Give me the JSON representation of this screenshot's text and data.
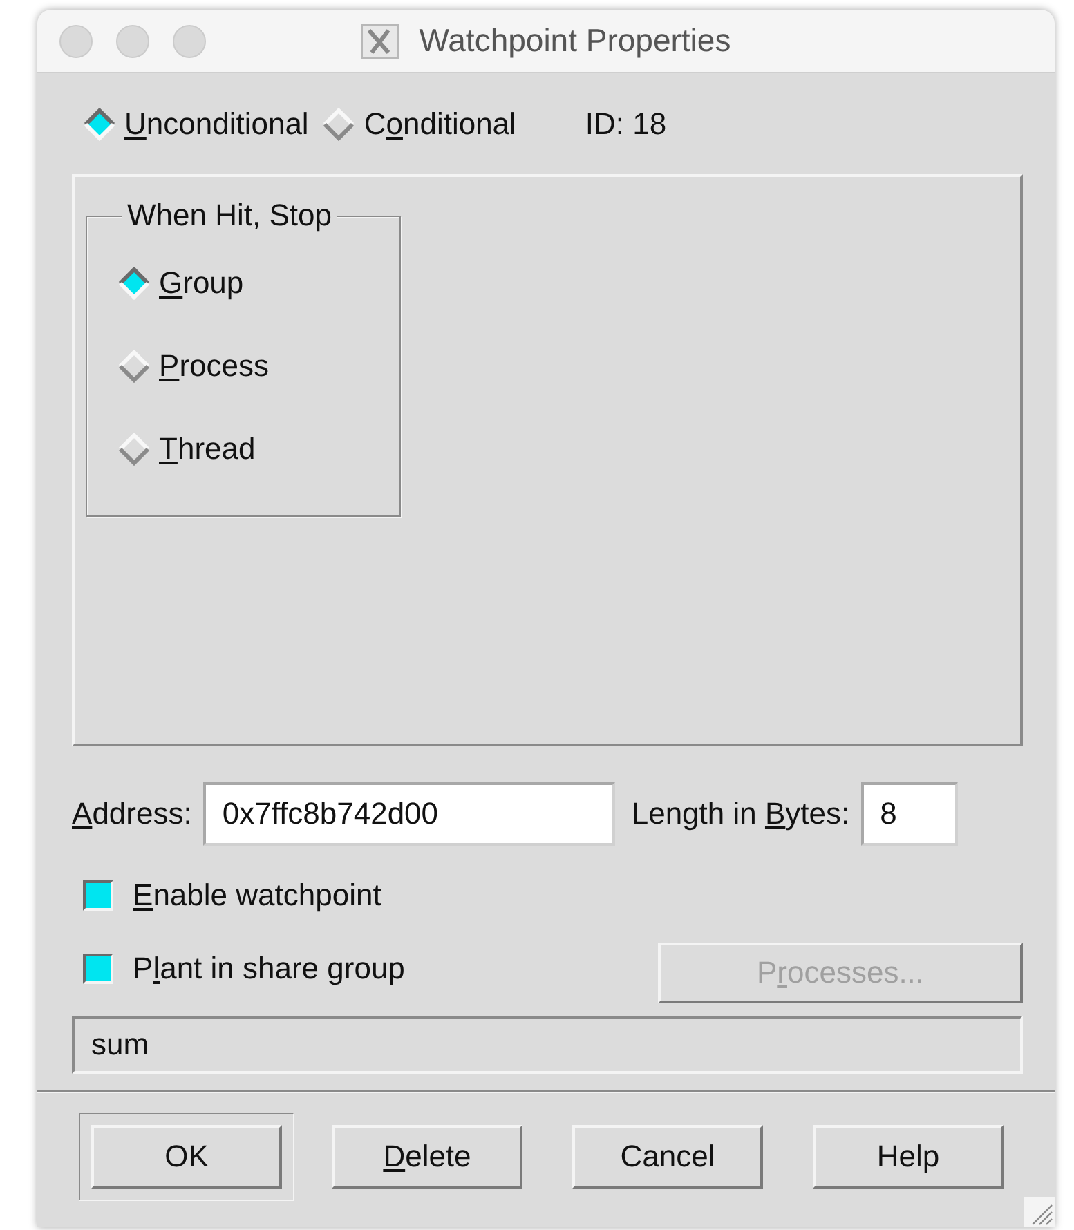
{
  "window": {
    "title": "Watchpoint Properties"
  },
  "condition_options": [
    {
      "label": {
        "key": "U",
        "post": "nconditional"
      },
      "selected": true
    },
    {
      "label": {
        "pre": "C",
        "key": "o",
        "post": "nditional"
      },
      "selected": false
    }
  ],
  "id_label": "ID: 18",
  "stop_group": {
    "title": "When Hit, Stop",
    "options": [
      {
        "label": {
          "key": "G",
          "post": "roup"
        },
        "selected": true
      },
      {
        "label": {
          "key": "P",
          "post": "rocess"
        },
        "selected": false
      },
      {
        "label": {
          "key": "T",
          "post": "hread"
        },
        "selected": false
      }
    ]
  },
  "address": {
    "label": {
      "key": "A",
      "post": "ddress:"
    },
    "value": "0x7ffc8b742d00"
  },
  "length": {
    "label": {
      "pre": "Length in ",
      "key": "B",
      "post": "ytes:"
    },
    "value": "8"
  },
  "checkboxes": [
    {
      "label": {
        "key": "E",
        "post": "nable watchpoint"
      },
      "checked": true
    },
    {
      "label": {
        "pre": "P",
        "key": "l",
        "post": "ant in share group"
      },
      "checked": true
    }
  ],
  "processes_button": {
    "label": {
      "pre": "P",
      "key": "r",
      "post": "ocesses..."
    },
    "disabled": true
  },
  "expression_field": {
    "value": "sum"
  },
  "buttons": [
    {
      "label": {
        "post": "OK"
      },
      "default": true
    },
    {
      "label": {
        "key": "D",
        "post": "elete"
      },
      "default": false
    },
    {
      "label": {
        "post": "Cancel"
      },
      "default": false
    },
    {
      "label": {
        "post": "Help"
      },
      "default": false
    }
  ]
}
